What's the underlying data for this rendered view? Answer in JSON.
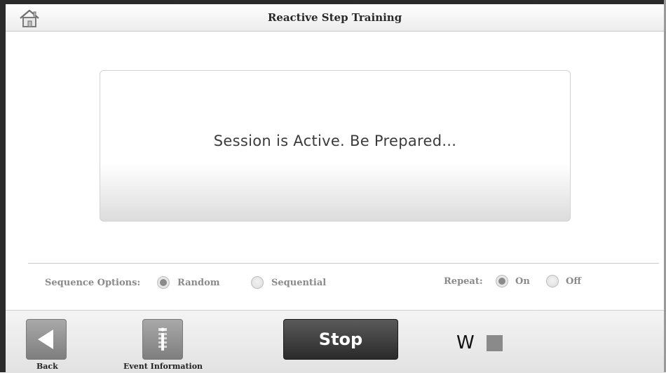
{
  "header": {
    "title": "Reactive Step Training",
    "home_icon": "home-icon"
  },
  "status_panel": {
    "message": "Session is Active. Be Prepared..."
  },
  "options": {
    "sequence_label": "Sequence Options:",
    "sequence_choices": [
      {
        "label": "Random",
        "selected": true
      },
      {
        "label": "Sequential",
        "selected": false
      }
    ],
    "repeat_label": "Repeat:",
    "repeat_choices": [
      {
        "label": "On",
        "selected": true
      },
      {
        "label": "Off",
        "selected": false
      }
    ]
  },
  "footer": {
    "back_label": "Back",
    "back_icon": "left-triangle-icon",
    "event_info_label": "Event Information",
    "event_info_icon": "info-list-icon",
    "stop_label": "Stop",
    "indicator_letter": "W",
    "indicator_color": "#8a8a8a"
  }
}
